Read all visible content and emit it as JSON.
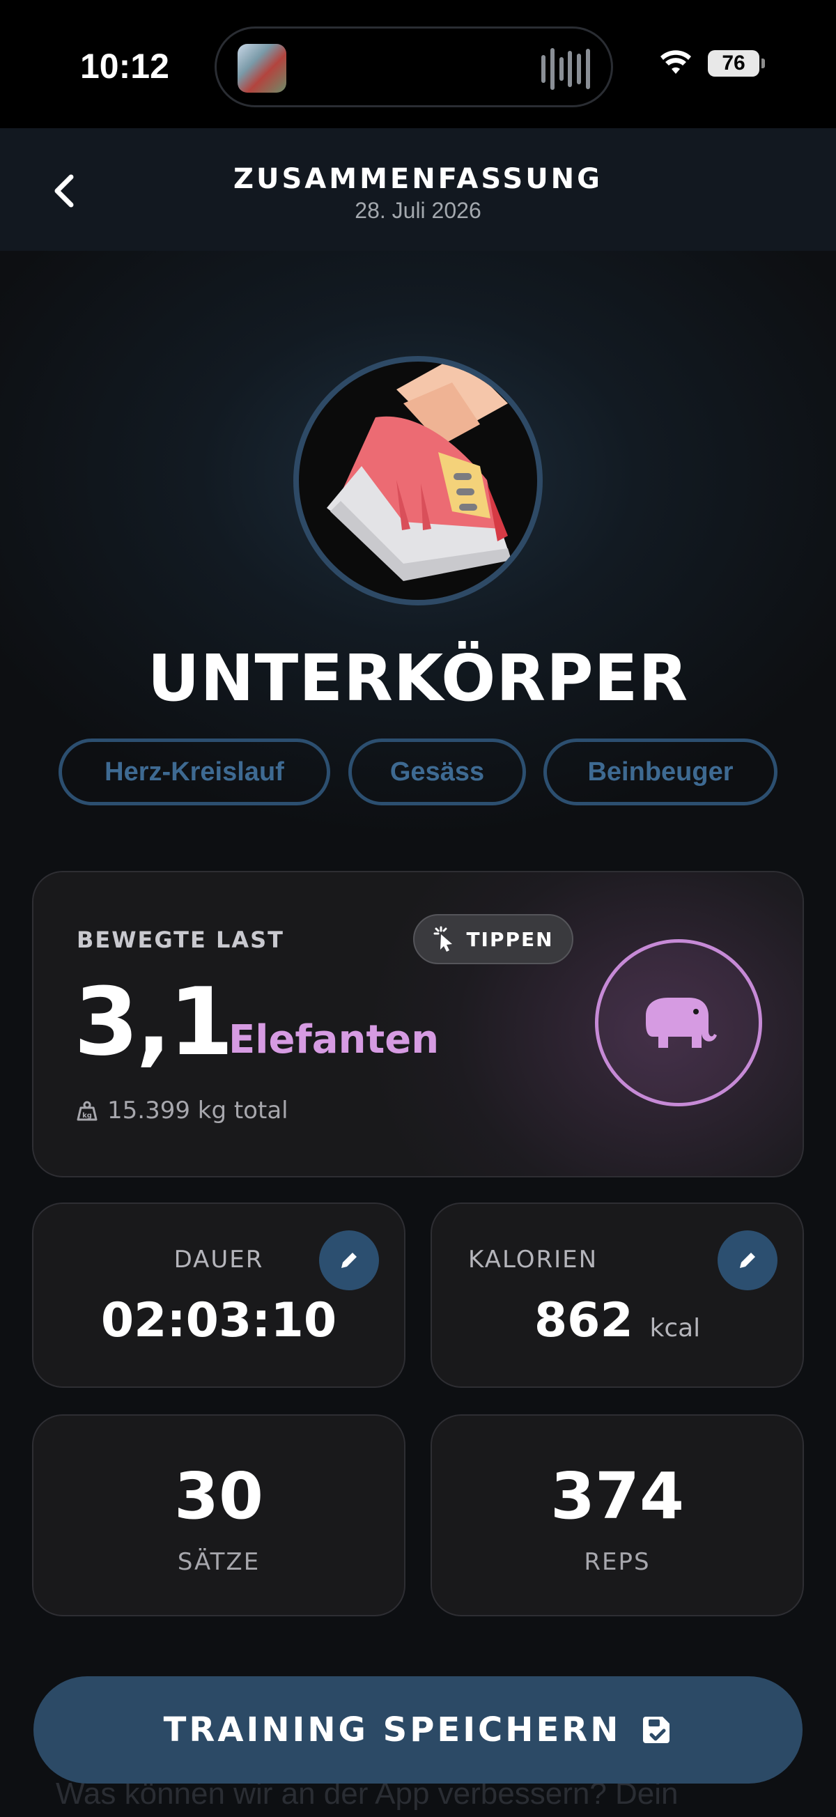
{
  "status_bar": {
    "time": "10:12",
    "battery": "76"
  },
  "header": {
    "title": "ZUSAMMENFASSUNG",
    "date": "28. Juli 2026"
  },
  "workout": {
    "title": "UNTERKÖRPER",
    "tags": [
      "Herz-Kreislauf",
      "Gesäss",
      "Beinbeuger"
    ]
  },
  "load": {
    "label": "BEWEGTE LAST",
    "tap_label": "TIPPEN",
    "value": "3,1",
    "unit": "Elefanten",
    "total": "15.399 kg total"
  },
  "stats": {
    "duration": {
      "label": "DAUER",
      "value": "02:03:10"
    },
    "calories": {
      "label": "KALORIEN",
      "value": "862",
      "unit": "kcal"
    },
    "sets": {
      "value": "30",
      "label": "SÄTZE"
    },
    "reps": {
      "value": "374",
      "label": "REPS"
    }
  },
  "footer": {
    "save_label": "TRAINING SPEICHERN",
    "hint": "Was können wir an der App verbessern? Dein"
  },
  "colors": {
    "accent_blue": "#2c4f70",
    "accent_purple": "#d69be2",
    "background": "#0d0f12"
  },
  "icons": [
    "back-chevron-icon",
    "wifi-icon",
    "sneaker-icon",
    "tap-icon",
    "weight-icon",
    "elephant-icon",
    "pencil-icon",
    "save-icon"
  ]
}
